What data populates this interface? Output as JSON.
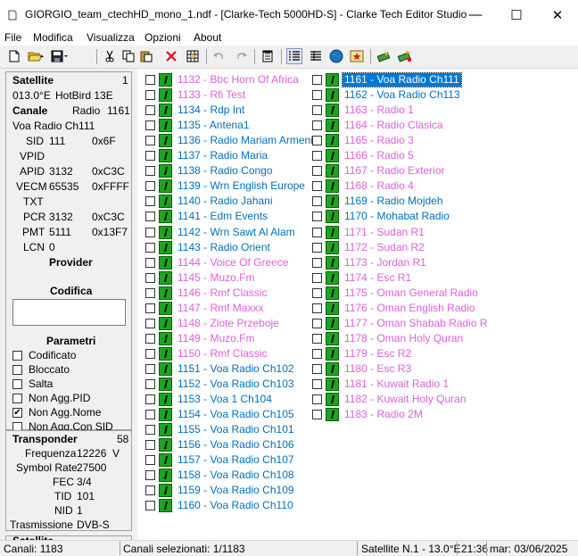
{
  "window": {
    "title": "GIORGIO_team_ctechHD_mono_1.ndf - [Clarke-Tech 5000HD-S] - Clarke Tech Editor Studio",
    "minimize": "—",
    "maximize": "☐",
    "close": "✕"
  },
  "menu": [
    "File",
    "Modifica",
    "Visualizza",
    "Opzioni",
    "About"
  ],
  "toolbar_icons": [
    "new-icon",
    "open-icon",
    "save-icon",
    "cut-icon",
    "copy-icon",
    "paste-icon",
    "delete-icon",
    "grid-icon",
    "undo-icon",
    "redo-icon",
    "properties-icon",
    "list-view-icon",
    "detail-view-icon",
    "satellite-icon",
    "star-icon",
    "send-icon",
    "receive-icon"
  ],
  "satellite": {
    "label": "Satellite",
    "number": "1",
    "position": "013.0°E",
    "name": "HotBird 13E"
  },
  "channel": {
    "label": "Canale",
    "type": "Radio",
    "number": "1161",
    "name": "Voa Radio Ch111",
    "fields": [
      {
        "k": "SID",
        "v": "111",
        "h": "0x6F"
      },
      {
        "k": "VPID",
        "v": "",
        "h": ""
      },
      {
        "k": "APID",
        "v": "3132",
        "h": "0xC3C"
      },
      {
        "k": "VECM",
        "v": "65535",
        "h": "0xFFFF"
      },
      {
        "k": "TXT",
        "v": "",
        "h": ""
      },
      {
        "k": "PCR",
        "v": "3132",
        "h": "0xC3C"
      },
      {
        "k": "PMT",
        "v": "5111",
        "h": "0x13F7"
      },
      {
        "k": "LCN",
        "v": "0",
        "h": ""
      }
    ],
    "provider_label": "Provider",
    "codifica_label": "Codifica",
    "parametri_label": "Parametri",
    "params": [
      {
        "label": "Codificato",
        "checked": false
      },
      {
        "label": "Bloccato",
        "checked": false
      },
      {
        "label": "Salta",
        "checked": false
      },
      {
        "label": "Non Agg.PID",
        "checked": false
      },
      {
        "label": "Non Agg.Nome",
        "checked": true
      },
      {
        "label": "Non Agg.Con SID",
        "checked": false
      }
    ]
  },
  "transponder": {
    "label": "Transponder",
    "number": "58",
    "fields": [
      {
        "k": "Frequenza",
        "v": "12226",
        "u": "V"
      },
      {
        "k": "Symbol Rate",
        "v": "27500",
        "u": ""
      },
      {
        "k": "FEC",
        "v": "3/4",
        "u": ""
      },
      {
        "k": "TID",
        "v": "101",
        "u": ""
      },
      {
        "k": "NID",
        "v": "1",
        "u": ""
      },
      {
        "k": "Trasmissione",
        "v": "DVB-S",
        "u": ""
      }
    ],
    "next_group_label": "Satellite"
  },
  "channels_col1": [
    {
      "t": "1132 - Bbc Horn Of Africa",
      "c": "radio"
    },
    {
      "t": "1133 - Rfi Test",
      "c": "radio"
    },
    {
      "t": "1134 - Rdp Int",
      "c": "tv"
    },
    {
      "t": "1135 - Antena1",
      "c": "tv"
    },
    {
      "t": "1136 - Radio Mariam Armeni",
      "c": "tv"
    },
    {
      "t": "1137 - Radio Maria",
      "c": "tv"
    },
    {
      "t": "1138 - Radio Congo",
      "c": "tv"
    },
    {
      "t": "1139 - Wrn English Europe",
      "c": "tv"
    },
    {
      "t": "1140 - Radio Jahani",
      "c": "tv"
    },
    {
      "t": "1141 - Edm Events",
      "c": "tv"
    },
    {
      "t": "1142 - Wrn Sawt Al Alam",
      "c": "tv"
    },
    {
      "t": "1143 - Radio Orient",
      "c": "tv"
    },
    {
      "t": "1144 - Voice Of Greece",
      "c": "radio"
    },
    {
      "t": "1145 - Muzo.Fm",
      "c": "radio"
    },
    {
      "t": "1146 - Rmf Classic",
      "c": "radio"
    },
    {
      "t": "1147 - Rmf Maxxx",
      "c": "radio"
    },
    {
      "t": "1148 - Zlote Przeboje",
      "c": "radio"
    },
    {
      "t": "1149 - Muzo.Fm",
      "c": "radio"
    },
    {
      "t": "1150 - Rmf Classic",
      "c": "radio"
    },
    {
      "t": "1151 - Voa Radio Ch102",
      "c": "tv"
    },
    {
      "t": "1152 - Voa Radio Ch103",
      "c": "tv"
    },
    {
      "t": "1153 - Voa 1 Ch104",
      "c": "tv"
    },
    {
      "t": "1154 - Voa Radio Ch105",
      "c": "tv"
    },
    {
      "t": "1155 - Voa Radio Ch101",
      "c": "tv"
    },
    {
      "t": "1156 - Voa Radio Ch106",
      "c": "tv"
    },
    {
      "t": "1157 - Voa Radio Ch107",
      "c": "tv"
    },
    {
      "t": "1158 - Voa Radio Ch108",
      "c": "tv"
    },
    {
      "t": "1159 - Voa Radio Ch109",
      "c": "tv"
    },
    {
      "t": "1160 - Voa Radio Ch110",
      "c": "tv"
    }
  ],
  "channels_col2": [
    {
      "t": "1161 - Voa Radio Ch111",
      "c": "sel"
    },
    {
      "t": "1162 - Voa Radio Ch113",
      "c": "tv"
    },
    {
      "t": "1163 - Radio 1",
      "c": "radio"
    },
    {
      "t": "1164 - Radio Clasica",
      "c": "radio"
    },
    {
      "t": "1165 - Radio 3",
      "c": "radio"
    },
    {
      "t": "1166 - Radio 5",
      "c": "radio"
    },
    {
      "t": "1167 - Radio Exterior",
      "c": "radio"
    },
    {
      "t": "1168 - Radio 4",
      "c": "radio"
    },
    {
      "t": "1169 - Radio Mojdeh",
      "c": "tv"
    },
    {
      "t": "1170 - Mohabat Radio",
      "c": "tv"
    },
    {
      "t": "1171 - Sudan R1",
      "c": "radio"
    },
    {
      "t": "1172 - Sudan R2",
      "c": "radio"
    },
    {
      "t": "1173 - Jordan R1",
      "c": "radio"
    },
    {
      "t": "1174 - Esc R1",
      "c": "radio"
    },
    {
      "t": "1175 - Oman General Radio",
      "c": "radio"
    },
    {
      "t": "1176 - Oman English Radio",
      "c": "radio"
    },
    {
      "t": "1177 - Oman Shabab Radio R",
      "c": "radio"
    },
    {
      "t": "1178 - Oman Holy Quran",
      "c": "radio"
    },
    {
      "t": "1179 - Esc R2",
      "c": "radio"
    },
    {
      "t": "1180 - Esc R3",
      "c": "radio"
    },
    {
      "t": "1181 - Kuwait Radio 1",
      "c": "radio"
    },
    {
      "t": "1182 - Kuwait Holy Quran",
      "c": "radio"
    },
    {
      "t": "1183 - Radio 2M",
      "c": "radio"
    }
  ],
  "colors": {
    "tv": "#0070c0",
    "radio": "#e060e0",
    "selected": "#0078d7"
  },
  "status": {
    "canali": "Canali: 1183",
    "selezionati": "Canali selezionati: 1/1183",
    "satellite": "Satellite N.1 - 13.0°E",
    "time": "21:36",
    "date": "mar: 03/06/2025"
  }
}
